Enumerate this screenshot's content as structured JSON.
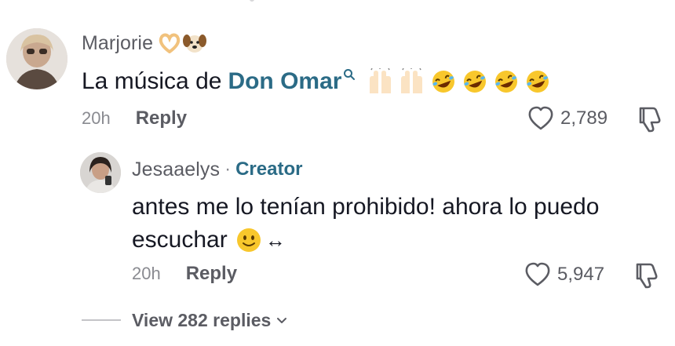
{
  "comments": [
    {
      "author": "Marjorie",
      "text_prefix": "La música de",
      "link": "Don Omar",
      "time": "20h",
      "reply_label": "Reply",
      "likes": "2,789"
    },
    {
      "author": "Jesaaelys",
      "separator": "·",
      "badge": "Creator",
      "line1": "antes me lo tenían prohibido! ahora lo puedo",
      "line2": "escuchar",
      "arrow": "↔",
      "time": "20h",
      "reply_label": "Reply",
      "likes": "5,947"
    }
  ],
  "view_replies": "View 282 replies",
  "colors": {
    "text": "#161823",
    "muted": "#5b5c63",
    "faint": "#8a8b91",
    "link": "#2b6b86"
  },
  "icons": [
    "heart-hands-icon",
    "dog-face-icon",
    "search-icon",
    "raising-hands-icon",
    "rolling-laughing-icon",
    "slightly-smiling-icon",
    "heart-outline-icon",
    "dislike-icon",
    "chevron-down-icon"
  ]
}
